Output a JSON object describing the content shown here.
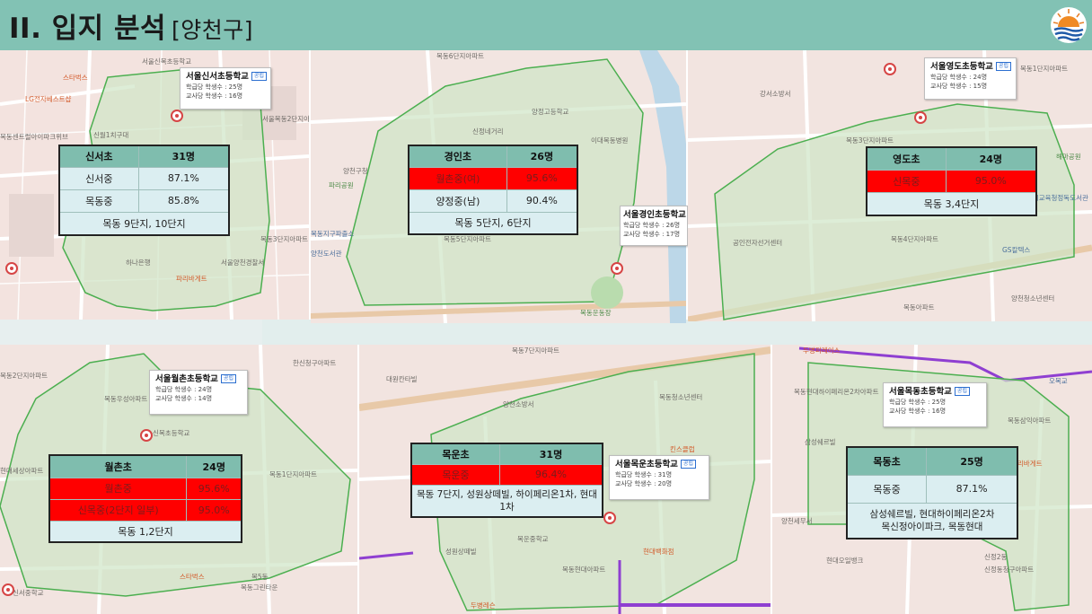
{
  "header": {
    "title": "II. 입지 분석",
    "subtitle": "[양천구]"
  },
  "colors": {
    "header_bg": "#82c2b4",
    "zone_fill": "#d9ead3",
    "zone_stroke": "#4caf50",
    "table_header": "#7fbdae",
    "table_row": "#dbeef1",
    "highlight_red": "#ff0000"
  },
  "panels": [
    {
      "school": {
        "name": "서울신서초등학교",
        "tag": "공립",
        "per_class": "학급당 학생수 : 25명",
        "per_teacher": "교사당 학생수 : 16명"
      },
      "table": {
        "school": "신서초",
        "count": "31명",
        "rows": [
          {
            "name": "신서중",
            "value": "87.1%",
            "highlight": false
          },
          {
            "name": "목동중",
            "value": "85.8%",
            "highlight": false
          }
        ],
        "footer": "목동 9단지, 10단지"
      },
      "labels": [
        "스타벅스",
        "LG전자베스트샵",
        "신월1치구대",
        "목동센트럴아이파크위브",
        "하나은행",
        "서울양천경찰서",
        "파리바게트",
        "서울신목초등학교",
        "서울목동2단지아파트",
        "목동3단지아파트"
      ]
    },
    {
      "school": {
        "name": "서울경인초등학교",
        "tag": "",
        "per_class": "학급당 학생수 : 26명",
        "per_teacher": "교사당 학생수 : 17명"
      },
      "table": {
        "school": "경인초",
        "count": "26명",
        "rows": [
          {
            "name": "월촌중(여)",
            "value": "95.6%",
            "highlight": true
          },
          {
            "name": "양정중(남)",
            "value": "90.4%",
            "highlight": false
          }
        ],
        "footer": "목동 5단지, 6단지"
      },
      "labels": [
        "목동6단지아파트",
        "목동5단지아파트",
        "양정고등학교",
        "이대목동병원",
        "양천구청",
        "신정네거리",
        "목동지구파출소",
        "양천도서관",
        "파리공원",
        "목동운동장"
      ]
    },
    {
      "school": {
        "name": "서울영도초등학교",
        "tag": "공립",
        "per_class": "학급당 학생수 : 24명",
        "per_teacher": "교사당 학생수 : 15명"
      },
      "table": {
        "school": "영도초",
        "count": "24명",
        "rows": [
          {
            "name": "신목중",
            "value": "95.0%",
            "highlight": true
          }
        ],
        "footer": "목동 3,4단지"
      },
      "labels": [
        "목동3단지아파트",
        "목동4단지아파트",
        "목동1단지아파트",
        "강서소방서",
        "해마공원",
        "GS칼텍스",
        "공인전자선거센터",
        "양천청소년센터",
        "서울시교육청정독도서관",
        "목동아파트"
      ]
    },
    {
      "school": {
        "name": "서울월촌초등학교",
        "tag": "공립",
        "per_class": "학급당 학생수 : 24명",
        "per_teacher": "교사당 학생수 : 14명"
      },
      "table": {
        "school": "월촌초",
        "count": "24명",
        "rows": [
          {
            "name": "월촌중",
            "value": "95.6%",
            "highlight": true
          },
          {
            "name": "신목중(2단지 일부)",
            "value": "95.0%",
            "highlight": true
          }
        ],
        "footer": "목동 1,2단지"
      },
      "labels": [
        "목동2단지아파트",
        "한신청구아파트",
        "목동1단지아파트",
        "목동우성아파트",
        "신목초등학교",
        "스타벅스",
        "목5동",
        "목동그린타운",
        "현대세상아파트",
        "신서중학교"
      ]
    },
    {
      "school": {
        "name": "서울목운초등학교",
        "tag": "공립",
        "per_class": "학급당 학생수 : 31명",
        "per_teacher": "교사당 학생수 : 20명"
      },
      "table": {
        "school": "목운초",
        "count": "31명",
        "rows": [
          {
            "name": "목운중",
            "value": "96.4%",
            "highlight": true
          }
        ],
        "footer": "목동 7단지, 성원상떼빌, 하이페리온1차, 현대1차"
      },
      "labels": [
        "목동7단지아파트",
        "대원칸타빌",
        "양천소방서",
        "목동청소년센터",
        "킨스클럽",
        "목운중학교",
        "현대백화점",
        "목동현대아파트",
        "성원상떼빌",
        "두병레슨"
      ]
    },
    {
      "school": {
        "name": "서울목동초등학교",
        "tag": "공립",
        "per_class": "학급당 학생수 : 25명",
        "per_teacher": "교사당 학생수 : 16명"
      },
      "table": {
        "school": "목동초",
        "count": "25명",
        "rows": [
          {
            "name": "목동중",
            "value": "87.1%",
            "highlight": false
          }
        ],
        "footer": "삼성쉐르빌, 현대하이페리온2차\n목신정아이파크, 목동현대"
      },
      "labels": [
        "두병퍼레이스",
        "목동현대하이페리온2차아파트",
        "삼성쉐르빌",
        "목동삼익아파트",
        "양천세무서",
        "신정2동",
        "신정동청구아파트",
        "오목교",
        "현대오일뱅크",
        "파리바게트"
      ]
    }
  ]
}
